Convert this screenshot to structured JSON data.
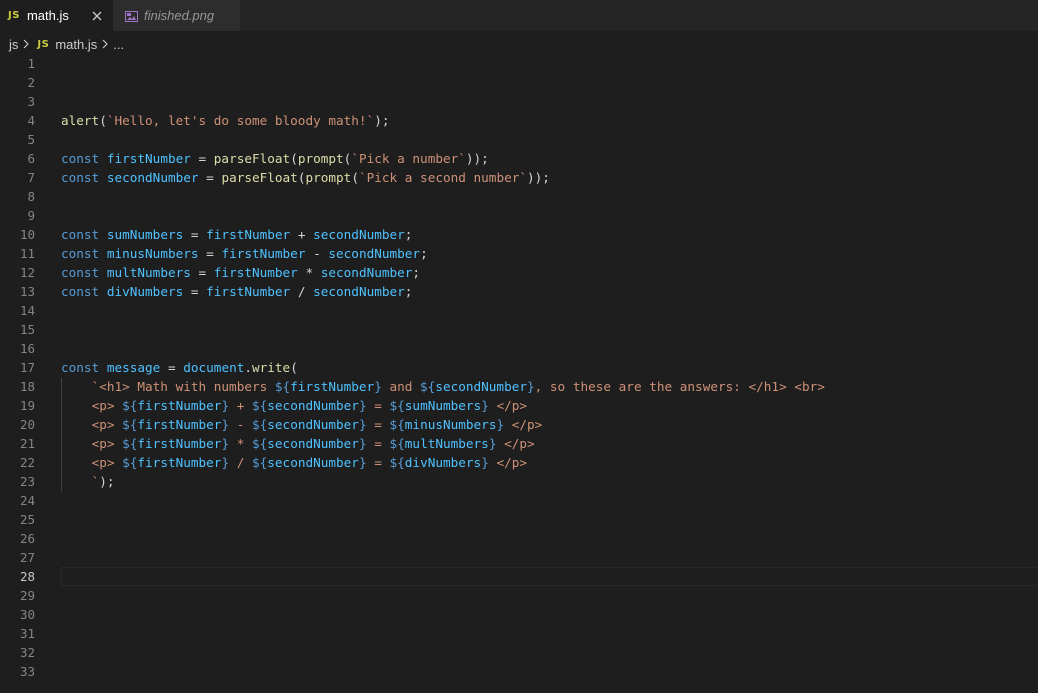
{
  "tabs": [
    {
      "badge": "JS",
      "label": "math.js",
      "active": true
    },
    {
      "label": "finished.png",
      "active": false
    }
  ],
  "breadcrumb": {
    "folder": "js",
    "badge": "JS",
    "file": "math.js",
    "more": "..."
  },
  "editor": {
    "current_line": 28,
    "lines": [
      {
        "n": "1",
        "tokens": []
      },
      {
        "n": "2",
        "tokens": []
      },
      {
        "n": "3",
        "tokens": []
      },
      {
        "n": "4",
        "tokens": [
          [
            "fn",
            "alert"
          ],
          [
            "op",
            "("
          ],
          [
            "str",
            "`Hello, let's do some bloody math!`"
          ],
          [
            "op",
            ");"
          ]
        ]
      },
      {
        "n": "5",
        "tokens": []
      },
      {
        "n": "6",
        "tokens": [
          [
            "kw",
            "const "
          ],
          [
            "var",
            "firstNumber"
          ],
          [
            "op",
            " = "
          ],
          [
            "fn",
            "parseFloat"
          ],
          [
            "op",
            "("
          ],
          [
            "fn",
            "prompt"
          ],
          [
            "op",
            "("
          ],
          [
            "str",
            "`Pick a number`"
          ],
          [
            "op",
            "));"
          ]
        ]
      },
      {
        "n": "7",
        "tokens": [
          [
            "kw",
            "const "
          ],
          [
            "var",
            "secondNumber"
          ],
          [
            "op",
            " = "
          ],
          [
            "fn",
            "parseFloat"
          ],
          [
            "op",
            "("
          ],
          [
            "fn",
            "prompt"
          ],
          [
            "op",
            "("
          ],
          [
            "str",
            "`Pick a second number`"
          ],
          [
            "op",
            "));"
          ]
        ]
      },
      {
        "n": "8",
        "tokens": []
      },
      {
        "n": "9",
        "tokens": []
      },
      {
        "n": "10",
        "tokens": [
          [
            "kw",
            "const "
          ],
          [
            "var",
            "sumNumbers"
          ],
          [
            "op",
            " = "
          ],
          [
            "var",
            "firstNumber"
          ],
          [
            "op",
            " + "
          ],
          [
            "var",
            "secondNumber"
          ],
          [
            "op",
            ";"
          ]
        ]
      },
      {
        "n": "11",
        "tokens": [
          [
            "kw",
            "const "
          ],
          [
            "var",
            "minusNumbers"
          ],
          [
            "op",
            " = "
          ],
          [
            "var",
            "firstNumber"
          ],
          [
            "op",
            " - "
          ],
          [
            "var",
            "secondNumber"
          ],
          [
            "op",
            ";"
          ]
        ]
      },
      {
        "n": "12",
        "tokens": [
          [
            "kw",
            "const "
          ],
          [
            "var",
            "multNumbers"
          ],
          [
            "op",
            " = "
          ],
          [
            "var",
            "firstNumber"
          ],
          [
            "op",
            " * "
          ],
          [
            "var",
            "secondNumber"
          ],
          [
            "op",
            ";"
          ]
        ]
      },
      {
        "n": "13",
        "tokens": [
          [
            "kw",
            "const "
          ],
          [
            "var",
            "divNumbers"
          ],
          [
            "op",
            " = "
          ],
          [
            "var",
            "firstNumber"
          ],
          [
            "op",
            " / "
          ],
          [
            "var",
            "secondNumber"
          ],
          [
            "op",
            ";"
          ]
        ]
      },
      {
        "n": "14",
        "tokens": []
      },
      {
        "n": "15",
        "tokens": []
      },
      {
        "n": "16",
        "tokens": []
      },
      {
        "n": "17",
        "tokens": [
          [
            "kw",
            "const "
          ],
          [
            "var",
            "message"
          ],
          [
            "op",
            " = "
          ],
          [
            "var",
            "document"
          ],
          [
            "op",
            "."
          ],
          [
            "fn",
            "write"
          ],
          [
            "op",
            "("
          ]
        ]
      },
      {
        "n": "18",
        "tokens": [
          [
            "op",
            "    "
          ],
          [
            "str",
            "`<h1> Math with numbers "
          ],
          [
            "interp",
            "${"
          ],
          [
            "var",
            "firstNumber"
          ],
          [
            "interp",
            "}"
          ],
          [
            "str",
            " and "
          ],
          [
            "interp",
            "${"
          ],
          [
            "var",
            "secondNumber"
          ],
          [
            "interp",
            "}"
          ],
          [
            "str",
            ", so these are the answers: </h1> <br>"
          ]
        ]
      },
      {
        "n": "19",
        "tokens": [
          [
            "op",
            "    "
          ],
          [
            "str",
            "<p> "
          ],
          [
            "interp",
            "${"
          ],
          [
            "var",
            "firstNumber"
          ],
          [
            "interp",
            "}"
          ],
          [
            "str",
            " + "
          ],
          [
            "interp",
            "${"
          ],
          [
            "var",
            "secondNumber"
          ],
          [
            "interp",
            "}"
          ],
          [
            "str",
            " = "
          ],
          [
            "interp",
            "${"
          ],
          [
            "var",
            "sumNumbers"
          ],
          [
            "interp",
            "}"
          ],
          [
            "str",
            " </p>"
          ]
        ]
      },
      {
        "n": "20",
        "tokens": [
          [
            "op",
            "    "
          ],
          [
            "str",
            "<p> "
          ],
          [
            "interp",
            "${"
          ],
          [
            "var",
            "firstNumber"
          ],
          [
            "interp",
            "}"
          ],
          [
            "str",
            " - "
          ],
          [
            "interp",
            "${"
          ],
          [
            "var",
            "secondNumber"
          ],
          [
            "interp",
            "}"
          ],
          [
            "str",
            " = "
          ],
          [
            "interp",
            "${"
          ],
          [
            "var",
            "minusNumbers"
          ],
          [
            "interp",
            "}"
          ],
          [
            "str",
            " </p>"
          ]
        ]
      },
      {
        "n": "21",
        "tokens": [
          [
            "op",
            "    "
          ],
          [
            "str",
            "<p> "
          ],
          [
            "interp",
            "${"
          ],
          [
            "var",
            "firstNumber"
          ],
          [
            "interp",
            "}"
          ],
          [
            "str",
            " * "
          ],
          [
            "interp",
            "${"
          ],
          [
            "var",
            "secondNumber"
          ],
          [
            "interp",
            "}"
          ],
          [
            "str",
            " = "
          ],
          [
            "interp",
            "${"
          ],
          [
            "var",
            "multNumbers"
          ],
          [
            "interp",
            "}"
          ],
          [
            "str",
            " </p>"
          ]
        ]
      },
      {
        "n": "22",
        "tokens": [
          [
            "op",
            "    "
          ],
          [
            "str",
            "<p> "
          ],
          [
            "interp",
            "${"
          ],
          [
            "var",
            "firstNumber"
          ],
          [
            "interp",
            "}"
          ],
          [
            "str",
            " / "
          ],
          [
            "interp",
            "${"
          ],
          [
            "var",
            "secondNumber"
          ],
          [
            "interp",
            "}"
          ],
          [
            "str",
            " = "
          ],
          [
            "interp",
            "${"
          ],
          [
            "var",
            "divNumbers"
          ],
          [
            "interp",
            "}"
          ],
          [
            "str",
            " </p>"
          ]
        ]
      },
      {
        "n": "23",
        "tokens": [
          [
            "op",
            "    "
          ],
          [
            "str",
            "`"
          ],
          [
            "op",
            ");"
          ]
        ]
      },
      {
        "n": "24",
        "tokens": []
      },
      {
        "n": "25",
        "tokens": []
      },
      {
        "n": "26",
        "tokens": []
      },
      {
        "n": "27",
        "tokens": []
      },
      {
        "n": "28",
        "tokens": []
      },
      {
        "n": "29",
        "tokens": []
      },
      {
        "n": "30",
        "tokens": []
      },
      {
        "n": "31",
        "tokens": []
      },
      {
        "n": "32",
        "tokens": []
      },
      {
        "n": "33",
        "tokens": []
      }
    ]
  }
}
